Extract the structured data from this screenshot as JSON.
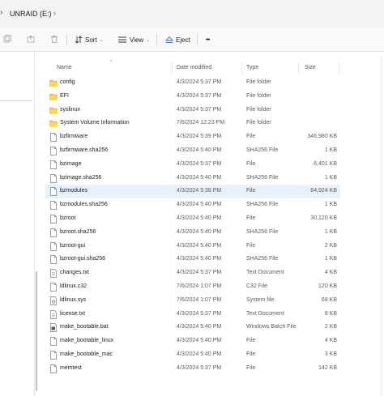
{
  "address": {
    "location": "UNRAID (E:)"
  },
  "toolbar": {
    "sort_label": "Sort",
    "view_label": "View",
    "eject_label": "Eject",
    "more_label": "•••"
  },
  "columns": {
    "name": "Name",
    "date": "Date modified",
    "type": "Type",
    "size": "Size"
  },
  "files": [
    {
      "name": "config",
      "date": "4/3/2024 5:37 PM",
      "type": "File folder",
      "size": "",
      "icon": "folder-icon"
    },
    {
      "name": "EFI",
      "date": "4/3/2024 5:37 PM",
      "type": "File folder",
      "size": "",
      "icon": "folder-icon"
    },
    {
      "name": "syslinux",
      "date": "4/3/2024 5:37 PM",
      "type": "File folder",
      "size": "",
      "icon": "folder-icon"
    },
    {
      "name": "System Volume Information",
      "date": "7/6/2024 12:23 PM",
      "type": "File folder",
      "size": "",
      "icon": "folder-icon"
    },
    {
      "name": "bzfirmware",
      "date": "4/3/2024 5:39 PM",
      "type": "File",
      "size": "346,980 KB",
      "icon": "file-icon"
    },
    {
      "name": "bzfirmware.sha256",
      "date": "4/3/2024 5:40 PM",
      "type": "SHA256 File",
      "size": "1 KB",
      "icon": "file-icon"
    },
    {
      "name": "bzimage",
      "date": "4/3/2024 5:37 PM",
      "type": "File",
      "size": "6,401 KB",
      "icon": "file-icon"
    },
    {
      "name": "bzimage.sha256",
      "date": "4/3/2024 5:40 PM",
      "type": "SHA256 File",
      "size": "1 KB",
      "icon": "file-icon"
    },
    {
      "name": "bzmodules",
      "date": "4/3/2024 5:38 PM",
      "type": "File",
      "size": "64,924 KB",
      "icon": "file-icon",
      "selected": true
    },
    {
      "name": "bzmodules.sha256",
      "date": "4/3/2024 5:40 PM",
      "type": "SHA256 File",
      "size": "1 KB",
      "icon": "file-icon"
    },
    {
      "name": "bzroot",
      "date": "4/3/2024 5:40 PM",
      "type": "File",
      "size": "30,120 KB",
      "icon": "file-icon"
    },
    {
      "name": "bzroot.sha256",
      "date": "4/3/2024 5:40 PM",
      "type": "SHA256 File",
      "size": "1 KB",
      "icon": "file-icon"
    },
    {
      "name": "bzroot-gui",
      "date": "4/3/2024 5:40 PM",
      "type": "File",
      "size": "2 KB",
      "icon": "file-icon"
    },
    {
      "name": "bzroot-gui.sha256",
      "date": "4/3/2024 5:40 PM",
      "type": "SHA256 File",
      "size": "1 KB",
      "icon": "file-icon"
    },
    {
      "name": "changes.txt",
      "date": "4/3/2024 5:37 PM",
      "type": "Text Document",
      "size": "4 KB",
      "icon": "text-file-icon"
    },
    {
      "name": "ldlinux.c32",
      "date": "7/6/2024 1:07 PM",
      "type": "C32 File",
      "size": "120 KB",
      "icon": "file-icon"
    },
    {
      "name": "ldlinux.sys",
      "date": "7/6/2024 1:07 PM",
      "type": "System file",
      "size": "68 KB",
      "icon": "system-file-icon"
    },
    {
      "name": "license.txt",
      "date": "4/3/2024 5:37 PM",
      "type": "Text Document",
      "size": "8 KB",
      "icon": "text-file-icon"
    },
    {
      "name": "make_bootable.bat",
      "date": "4/3/2024 5:40 PM",
      "type": "Windows Batch File",
      "size": "2 KB",
      "icon": "batch-file-icon"
    },
    {
      "name": "make_bootable_linux",
      "date": "4/3/2024 5:40 PM",
      "type": "File",
      "size": "4 KB",
      "icon": "file-icon"
    },
    {
      "name": "make_bootable_mac",
      "date": "4/3/2024 5:40 PM",
      "type": "File",
      "size": "3 KB",
      "icon": "file-icon"
    },
    {
      "name": "memtest",
      "date": "4/3/2024 5:37 PM",
      "type": "File",
      "size": "142 KB",
      "icon": "file-icon"
    }
  ]
}
